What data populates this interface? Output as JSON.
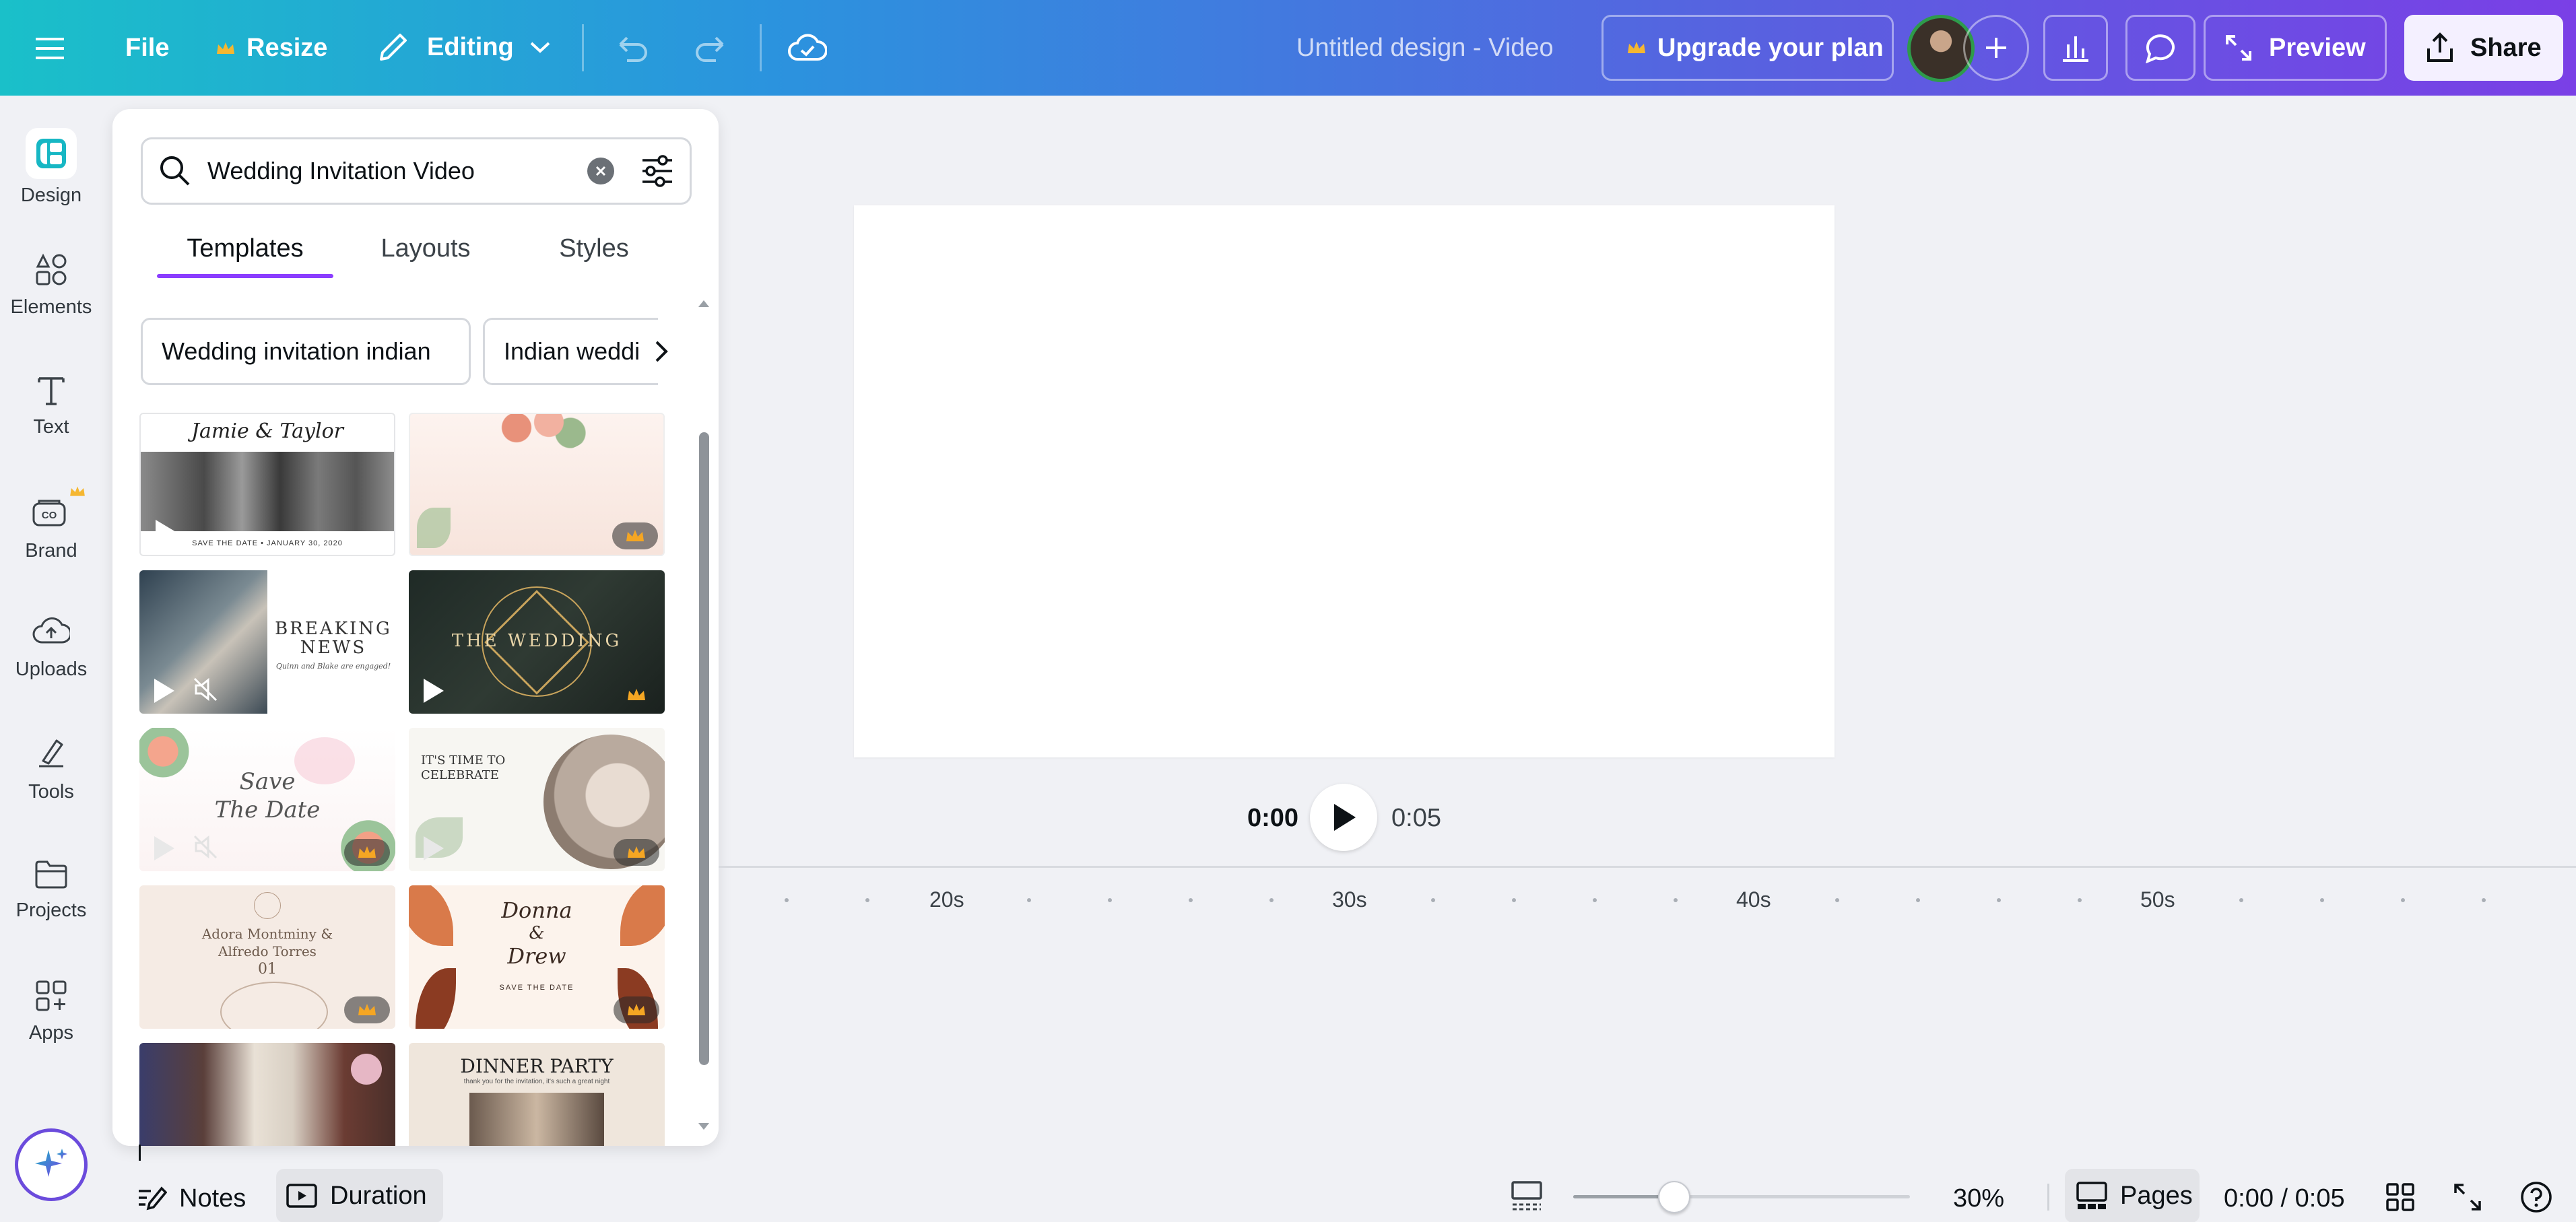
{
  "topbar": {
    "file": "File",
    "resize": "Resize",
    "editing": "Editing",
    "title": "Untitled design - Video",
    "upgrade": "Upgrade your plan",
    "preview": "Preview",
    "share": "Share"
  },
  "sidebar": {
    "items": [
      {
        "label": "Design",
        "icon": "design-icon"
      },
      {
        "label": "Elements",
        "icon": "elements-icon"
      },
      {
        "label": "Text",
        "icon": "text-icon"
      },
      {
        "label": "Brand",
        "icon": "brand-icon"
      },
      {
        "label": "Uploads",
        "icon": "uploads-icon"
      },
      {
        "label": "Tools",
        "icon": "tools-icon"
      },
      {
        "label": "Projects",
        "icon": "projects-icon"
      },
      {
        "label": "Apps",
        "icon": "apps-icon"
      }
    ]
  },
  "panel": {
    "search_value": "Wedding Invitation Video",
    "tabs": [
      "Templates",
      "Layouts",
      "Styles"
    ],
    "chips": [
      "Wedding invitation indian",
      "Indian weddi"
    ],
    "thumbs": {
      "t1_title": "Jamie & Taylor",
      "t1_sub": "SAVE THE DATE • JANUARY 30, 2020",
      "t3_l1": "BREAKING",
      "t3_l2": "NEWS",
      "t3_l3": "Quinn and Blake are engaged!",
      "t4_title": "THE WEDDING",
      "t5_l1": "Save",
      "t5_l2": "The Date",
      "t6_l1": "IT'S TIME TO",
      "t6_l2": "CELEBRATE",
      "t7_l1": "Adora Montminy &",
      "t7_l2": "Alfredo Torres",
      "t7_l3": "01",
      "t8_l1": "Donna",
      "t8_l2": "&",
      "t8_l3": "Drew",
      "t8_l4": "SAVE THE DATE",
      "t10_title": "DINNER PARTY",
      "t10_sub": "thank you for the invitation, it's such a great night"
    }
  },
  "player": {
    "current": "0:00",
    "total": "0:05"
  },
  "timeline": {
    "ticks": [
      "20s",
      "30s",
      "40s",
      "50s"
    ]
  },
  "bottom": {
    "notes": "Notes",
    "duration": "Duration",
    "zoom": "30%",
    "pages": "Pages",
    "time": "0:00 / 0:05",
    "zoom_level": 0.3
  },
  "colors": {
    "accent": "#8b3dff",
    "crown": "#f5a623"
  }
}
